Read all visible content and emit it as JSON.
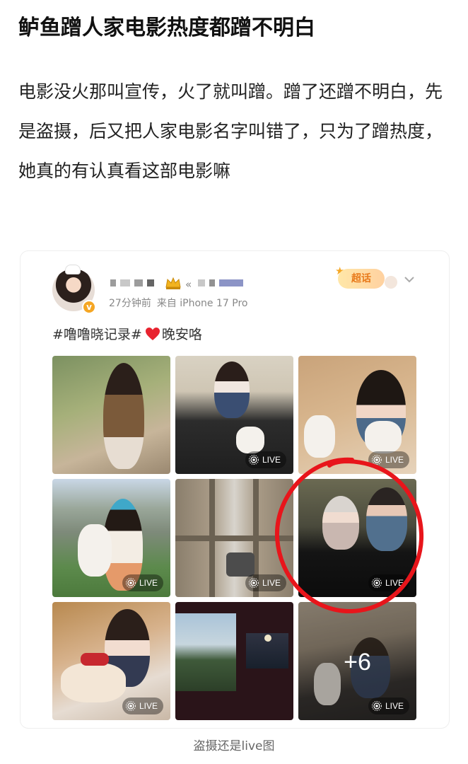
{
  "headline": "鲈鱼蹭人家电影热度都蹭不明白",
  "body_text": "电影没火那叫宣传，火了就叫蹭。蹭了还蹭不明白，先是盗摄，后又把人家电影名字叫错了，只为了蹭热度，她真的有认真看这部电影嘛",
  "post": {
    "time": "27分钟前",
    "source": "来自 iPhone 17 Pro",
    "super_tag": "超话",
    "topic": "#噜噜晓记录#",
    "text_after_heart": "晚安咯",
    "live_label": "LIVE",
    "more_count": "+6"
  },
  "icons": {
    "avatar": "avatar",
    "verified": "verified-badge-icon",
    "crown": "crown-icon",
    "chevron": "chevron-down-icon",
    "heart": "heart-icon",
    "live": "live-photo-icon"
  },
  "colors": {
    "annotation_circle": "#e8151b",
    "verified": "#f5a623",
    "heart": "#e8232f"
  },
  "caption": "盗摄还是live图"
}
